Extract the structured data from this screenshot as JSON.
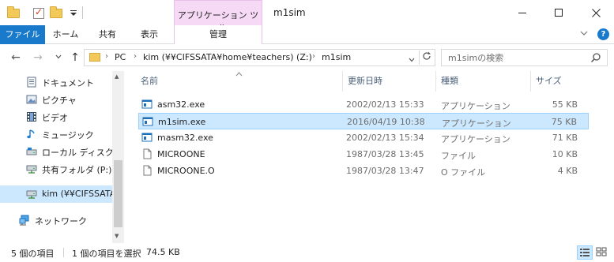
{
  "window": {
    "title": "m1sim",
    "contextual_tab_header": "アプリケーション ツール"
  },
  "ribbon": {
    "tabs": {
      "file": "ファイル",
      "home": "ホーム",
      "share": "共有",
      "view": "表示",
      "manage": "管理"
    },
    "help": "?"
  },
  "navigation": {
    "back_glyph": "←",
    "forward_glyph": "→",
    "up_glyph": "↑",
    "address": {
      "segments": [
        "PC",
        "kim (¥¥CIFSSATA¥home¥teachers) (Z:)",
        "m1sim"
      ]
    },
    "search_placeholder": "m1simの検索"
  },
  "nav_pane": {
    "items": [
      {
        "label": "ドキュメント",
        "icon": "documents-icon"
      },
      {
        "label": "ピクチャ",
        "icon": "pictures-icon"
      },
      {
        "label": "ビデオ",
        "icon": "videos-icon"
      },
      {
        "label": "ミュージック",
        "icon": "music-icon"
      },
      {
        "label": "ローカル ディスク (C",
        "icon": "local-disk-icon"
      },
      {
        "label": "共有フォルダ (P:)",
        "icon": "network-drive-icon"
      },
      {
        "label": "kim (¥¥CIFSSATA",
        "icon": "network-drive-icon",
        "selected": true
      },
      {
        "label": "ネットワーク",
        "icon": "network-icon"
      }
    ]
  },
  "file_list": {
    "columns": {
      "name": "名前",
      "date": "更新日時",
      "type": "種類",
      "size": "サイズ"
    },
    "rows": [
      {
        "name": "asm32.exe",
        "date": "2002/02/13 15:33",
        "type": "アプリケーション",
        "size": "55 KB",
        "icon": "exe-icon"
      },
      {
        "name": "m1sim.exe",
        "date": "2016/04/19 10:38",
        "type": "アプリケーション",
        "size": "75 KB",
        "icon": "exe-icon",
        "selected": true
      },
      {
        "name": "masm32.exe",
        "date": "2002/02/13 15:34",
        "type": "アプリケーション",
        "size": "71 KB",
        "icon": "exe-icon"
      },
      {
        "name": "MICROONE",
        "date": "1987/03/28 13:45",
        "type": "ファイル",
        "size": "10 KB",
        "icon": "file-icon"
      },
      {
        "name": "MICROONE.O",
        "date": "1987/03/28 13:47",
        "type": "O ファイル",
        "size": "4 KB",
        "icon": "file-icon"
      }
    ]
  },
  "status": {
    "item_count": "5 個の項目",
    "selection": "1 個の項目を選択",
    "selection_size": "74.5 KB"
  },
  "colors": {
    "accent": "#1979ca",
    "selection": "#cce8ff",
    "context_tab": "#f5d9f5"
  }
}
